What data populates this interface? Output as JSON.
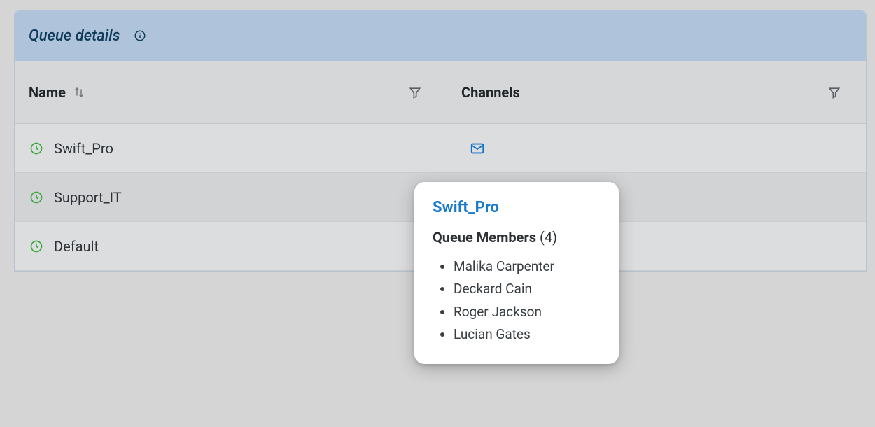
{
  "panel": {
    "title": "Queue details"
  },
  "columns": {
    "name": "Name",
    "channels": "Channels"
  },
  "rows": [
    {
      "name": "Swift_Pro",
      "hasMail": true
    },
    {
      "name": "Support_IT",
      "hasMail": false
    },
    {
      "name": "Default",
      "hasMail": false
    }
  ],
  "popover": {
    "title": "Swift_Pro",
    "subtitle_label": "Queue Members",
    "subtitle_count": "(4)",
    "members": [
      "Malika Carpenter",
      "Deckard Cain",
      "Roger Jackson",
      "Lucian Gates"
    ]
  }
}
